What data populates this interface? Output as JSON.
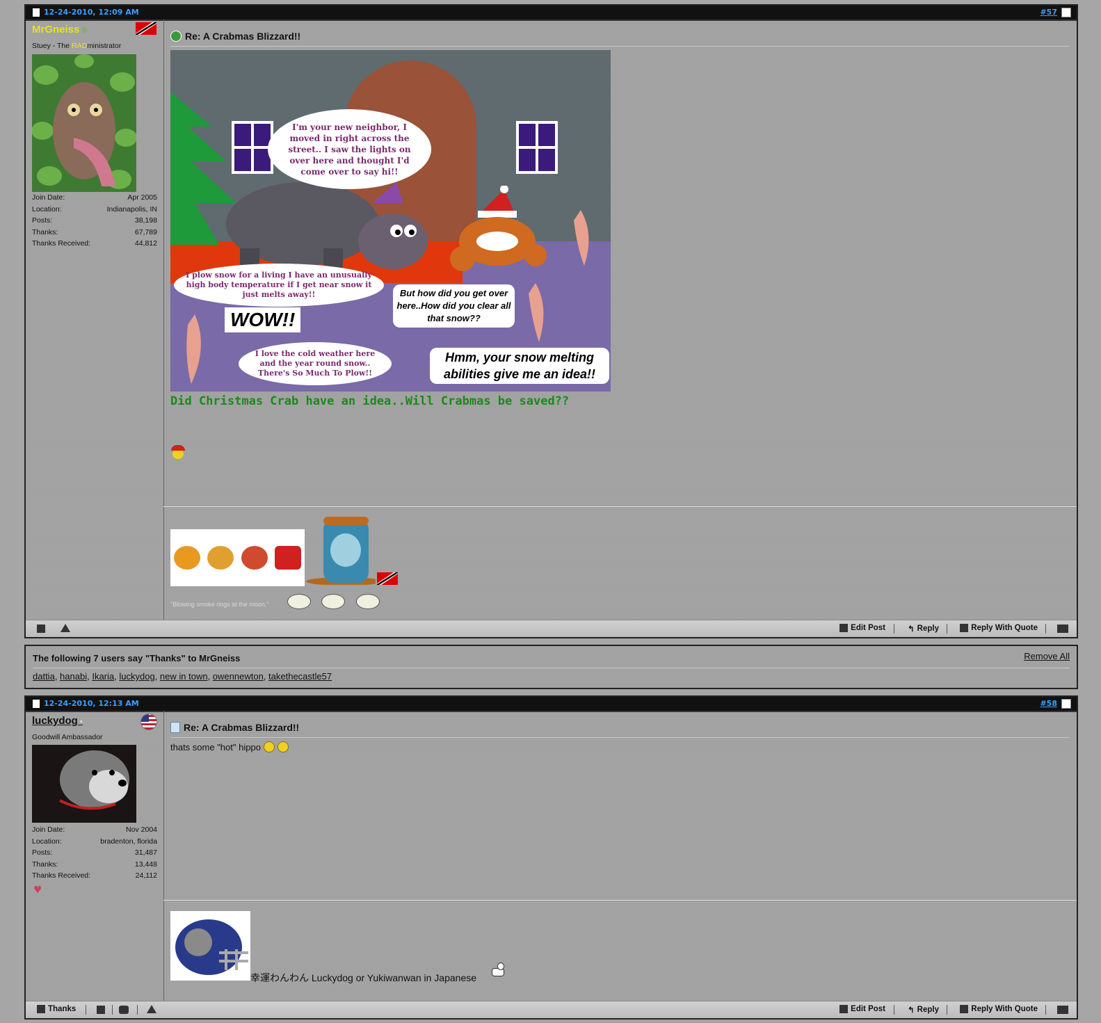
{
  "posts": [
    {
      "date": "12-24-2010, 12:09 AM",
      "number": "#57",
      "username": "MrGneiss",
      "user_title_prefix": "Stuey - The ",
      "user_title_highlight": "RAD",
      "user_title_suffix": "ministrator",
      "stats": [
        {
          "label": "Join Date:",
          "value": "Apr 2005"
        },
        {
          "label": "Location:",
          "value": "Indianapolis, IN"
        },
        {
          "label": "Posts:",
          "value": "38,198"
        },
        {
          "label": "Thanks:",
          "value": "67,789"
        },
        {
          "label": "Thanks Received:",
          "value": "44,812"
        }
      ],
      "title": "Re: A Crabmas Blizzard!!",
      "comic": {
        "bubble1": "I'm your new neighbor, I moved in right across the street.. I saw the lights on over here and thought I'd come over to say hi!!",
        "bubble2": "I plow snow for a living I have an unusually high body temperature if I get near snow it just melts away!!",
        "wow": "WOW!!",
        "bubble3": "I love the cold weather here and the year round snow.. There's So Much To Plow!!",
        "bubble4": "But how did you get over here..How did you clear all that snow??",
        "bubble5": "Hmm, your snow melting abilities give me an idea!!"
      },
      "body_text": "Did Christmas Crab have an idea..Will Crabmas be saved??",
      "signature_quote": "\"Blowing smoke rings at the moon.\""
    },
    {
      "date": "12-24-2010, 12:13 AM",
      "number": "#58",
      "username": "luckydog",
      "user_title": "Goodwill Ambassador",
      "stats": [
        {
          "label": "Join Date:",
          "value": "Nov 2004"
        },
        {
          "label": "Location:",
          "value": "bradenton, florida"
        },
        {
          "label": "Posts:",
          "value": "31,487"
        },
        {
          "label": "Thanks:",
          "value": "13,448"
        },
        {
          "label": "Thanks Received:",
          "value": "24,112"
        }
      ],
      "title": "Re: A Crabmas Blizzard!!",
      "body_text": "thats some \"hot\" hippo",
      "signature_text": "幸運わんわん Luckydog or Yukiwanwan in Japanese"
    }
  ],
  "footer": {
    "thanks": "Thanks",
    "edit_post": "Edit Post",
    "reply": "Reply",
    "reply_quote": "Reply With Quote"
  },
  "thanks_box": {
    "header": "The following 7 users say \"Thanks\" to MrGneiss",
    "remove_all": "Remove All",
    "users": [
      "dattia",
      "hanabi",
      "Ikaria",
      "luckydog",
      "new in town",
      "owennewton",
      "takethecastle57"
    ]
  },
  "colors": {
    "username_1": "#e8e020",
    "username_2": "#111111",
    "link_blue": "#3aa0ff",
    "green_text": "#1a8a1a"
  }
}
